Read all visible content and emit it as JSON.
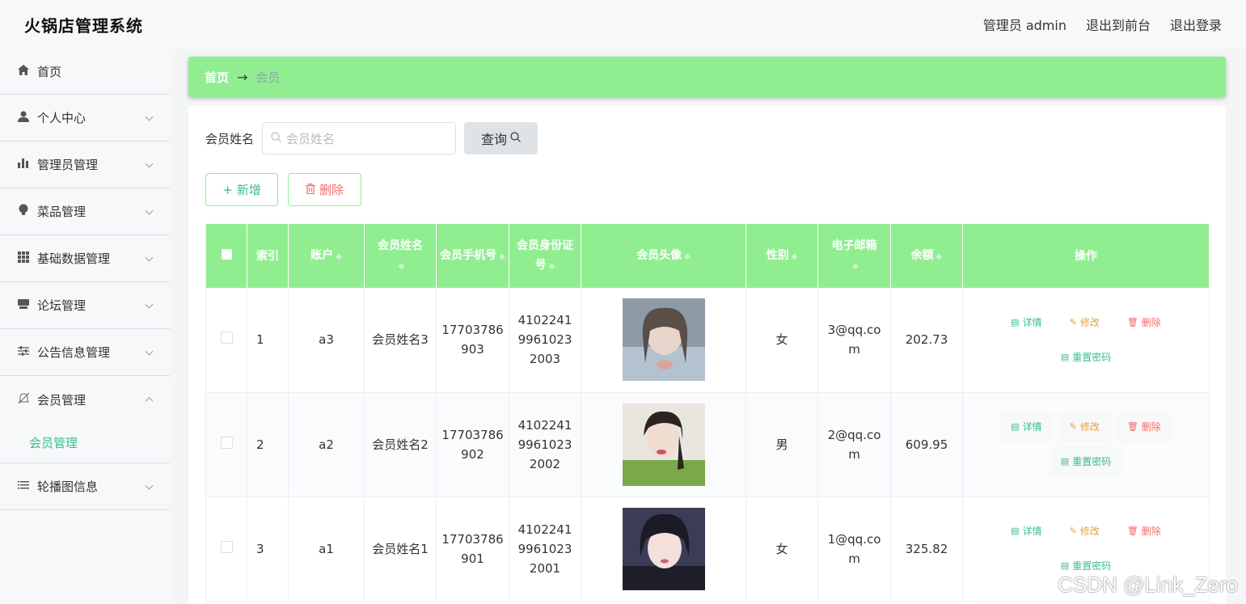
{
  "header": {
    "brand": "火锅店管理系统",
    "admin": "管理员 admin",
    "to_front": "退出到前台",
    "logout": "退出登录"
  },
  "sidebar": {
    "items": [
      {
        "label": "首页",
        "icon": "home-icon"
      },
      {
        "label": "个人中心",
        "icon": "user-icon"
      },
      {
        "label": "管理员管理",
        "icon": "bar-chart-icon"
      },
      {
        "label": "菜品管理",
        "icon": "bulb-icon"
      },
      {
        "label": "基础数据管理",
        "icon": "grid-icon"
      },
      {
        "label": "论坛管理",
        "icon": "box-icon"
      },
      {
        "label": "公告信息管理",
        "icon": "sliders-icon"
      },
      {
        "label": "会员管理",
        "icon": "bell-off-icon"
      },
      {
        "label": "轮播图信息",
        "icon": "list-icon"
      }
    ],
    "sub_active": "会员管理"
  },
  "breadcrumb": {
    "home": "首页",
    "current": "会员"
  },
  "search": {
    "label": "会员姓名",
    "placeholder": "会员姓名",
    "button": "查询"
  },
  "actions": {
    "add": "新增",
    "delete": "删除"
  },
  "table": {
    "headers": {
      "index": "索引",
      "account": "账户",
      "name": "会员姓名",
      "phone": "会员手机号",
      "id_card": "会员身份证号",
      "avatar": "会员头像",
      "gender": "性别",
      "email": "电子邮箱",
      "balance": "余额",
      "ops": "操作"
    },
    "rows": [
      {
        "index": "1",
        "account": "a3",
        "name": "会员姓名3",
        "phone": "17703786903",
        "id_card": "410224199610232003",
        "gender": "女",
        "email": "3@qq.com",
        "balance": "202.73"
      },
      {
        "index": "2",
        "account": "a2",
        "name": "会员姓名2",
        "phone": "17703786902",
        "id_card": "410224199610232002",
        "gender": "男",
        "email": "2@qq.com",
        "balance": "609.95"
      },
      {
        "index": "3",
        "account": "a1",
        "name": "会员姓名1",
        "phone": "17703786901",
        "id_card": "410224199610232001",
        "gender": "女",
        "email": "1@qq.com",
        "balance": "325.82"
      }
    ],
    "ops": {
      "detail": "详情",
      "edit": "修改",
      "delete": "删除",
      "reset": "重置密码"
    }
  },
  "watermark": "CSDN @Link_Zero",
  "colors": {
    "accent": "#90ee90",
    "active_text": "#3bbd8f",
    "danger": "#f56c6c",
    "warning": "#e6a23c"
  }
}
